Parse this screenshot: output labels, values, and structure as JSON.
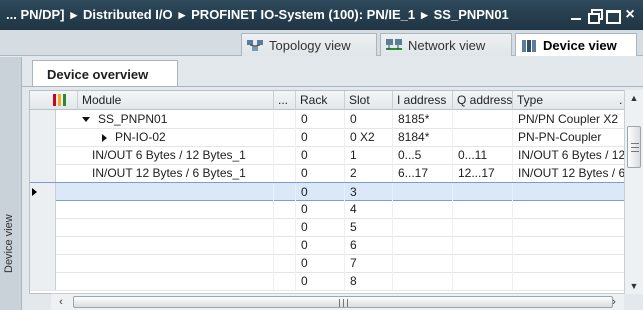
{
  "breadcrumb": [
    "... PN/DP]",
    "Distributed I/O",
    "PROFINET IO-System (100): PN/IE_1",
    "SS_PNPN01"
  ],
  "breadcrumb_separator": "▸",
  "view_tabs": [
    {
      "label": "Topology view",
      "icon": "topology-view-icon",
      "active": false
    },
    {
      "label": "Network view",
      "icon": "network-view-icon",
      "active": false
    },
    {
      "label": "Device view",
      "icon": "device-view-icon",
      "active": true
    }
  ],
  "side_label": "Device view",
  "overview_tab": "Device overview",
  "table": {
    "columns": [
      "Module",
      "...",
      "Rack",
      "Slot",
      "I address",
      "Q address",
      "Type",
      "."
    ],
    "rows": [
      {
        "module": "SS_PNPN01",
        "expand": "down",
        "indent": 1,
        "rack": "0",
        "slot": "0",
        "i_address": "8185*",
        "q_address": "",
        "type": "PN/PN Coupler X2"
      },
      {
        "module": "PN-IO-02",
        "expand": "right",
        "indent": 2,
        "rack": "0",
        "slot": "0 X2",
        "i_address": "8184*",
        "q_address": "",
        "type": "PN-PN-Coupler"
      },
      {
        "module": "IN/OUT 6 Bytes / 12 Bytes_1",
        "expand": "",
        "indent": 0,
        "rack": "0",
        "slot": "1",
        "i_address": "0...5",
        "q_address": "0...11",
        "type": "IN/OUT 6 Bytes / 12..."
      },
      {
        "module": "IN/OUT 12 Bytes / 6 Bytes_1",
        "expand": "",
        "indent": 0,
        "rack": "0",
        "slot": "2",
        "i_address": "6...17",
        "q_address": "12...17",
        "type": "IN/OUT 12 Bytes / 6..."
      },
      {
        "module": "",
        "expand": "",
        "indent": 0,
        "rack": "0",
        "slot": "3",
        "i_address": "",
        "q_address": "",
        "type": "",
        "selected": true
      },
      {
        "module": "",
        "expand": "",
        "indent": 0,
        "rack": "0",
        "slot": "4",
        "i_address": "",
        "q_address": "",
        "type": ""
      },
      {
        "module": "",
        "expand": "",
        "indent": 0,
        "rack": "0",
        "slot": "5",
        "i_address": "",
        "q_address": "",
        "type": ""
      },
      {
        "module": "",
        "expand": "",
        "indent": 0,
        "rack": "0",
        "slot": "6",
        "i_address": "",
        "q_address": "",
        "type": ""
      },
      {
        "module": "",
        "expand": "",
        "indent": 0,
        "rack": "0",
        "slot": "7",
        "i_address": "",
        "q_address": "",
        "type": ""
      },
      {
        "module": "",
        "expand": "",
        "indent": 0,
        "rack": "0",
        "slot": "8",
        "i_address": "",
        "q_address": "",
        "type": ""
      }
    ]
  },
  "colors": {
    "titlebar": "#1f3442",
    "selection": "#dbe8f8",
    "filter_icon_red": "#d0021b",
    "filter_icon_yellow": "#f5a623"
  }
}
